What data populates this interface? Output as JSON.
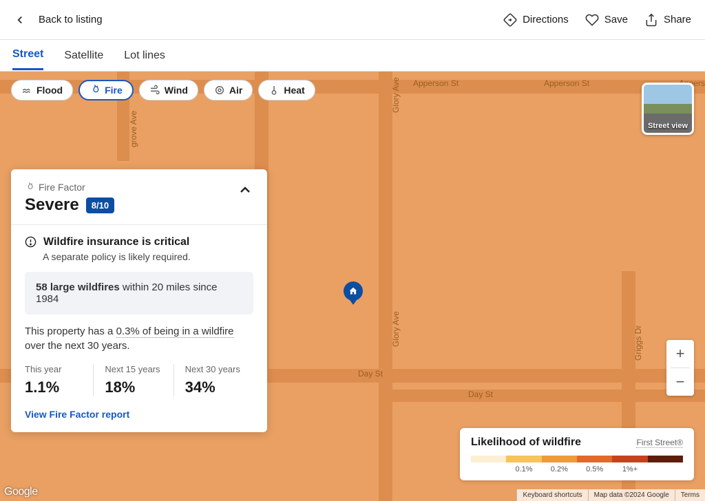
{
  "header": {
    "back_label": "Back to listing",
    "actions": {
      "directions": "Directions",
      "save": "Save",
      "share": "Share"
    }
  },
  "tabs": {
    "street": "Street",
    "satellite": "Satellite",
    "lot_lines": "Lot lines"
  },
  "chips": {
    "flood": "Flood",
    "fire": "Fire",
    "wind": "Wind",
    "air": "Air",
    "heat": "Heat"
  },
  "street_thumb": "Street view",
  "panel": {
    "factor_label": "Fire Factor",
    "severity": "Severe",
    "score": "8/10",
    "insurance_title": "Wildfire insurance is critical",
    "insurance_sub": "A separate policy is likely required.",
    "history_count": "58 large wildfires",
    "history_rest": " within 20 miles since 1984",
    "prob_pre": "This property has a ",
    "prob_val": "0.3% of being in a wildfire",
    "prob_post": " over the next 30 years.",
    "stats": {
      "this_year": {
        "label": "This year",
        "value": "1.1%"
      },
      "next_15": {
        "label": "Next 15 years",
        "value": "18%"
      },
      "next_30": {
        "label": "Next 30 years",
        "value": "34%"
      }
    },
    "report_link": "View Fire Factor report"
  },
  "legend": {
    "title": "Likelihood of wildfire",
    "source": "First Street®",
    "stops": [
      "0.1%",
      "0.2%",
      "0.5%",
      "1%+"
    ],
    "colors": [
      "#fcefd3",
      "#f6c45a",
      "#ee9a3a",
      "#e06a2b",
      "#c8411e",
      "#5c1d0b"
    ]
  },
  "map_roads": {
    "apperson_1": "Apperson St",
    "apperson_2": "Apperson St",
    "apperson_3": "Apperson St",
    "glory_1": "Glory Ave",
    "glory_2": "Glory Ave",
    "griggs": "Griggs Dr",
    "grove": "grove Ave",
    "day_1": "Day St",
    "day_2": "Day St"
  },
  "attrib": {
    "kb": "Keyboard shortcuts",
    "data": "Map data ©2024 Google",
    "terms": "Terms"
  },
  "google": "Google"
}
